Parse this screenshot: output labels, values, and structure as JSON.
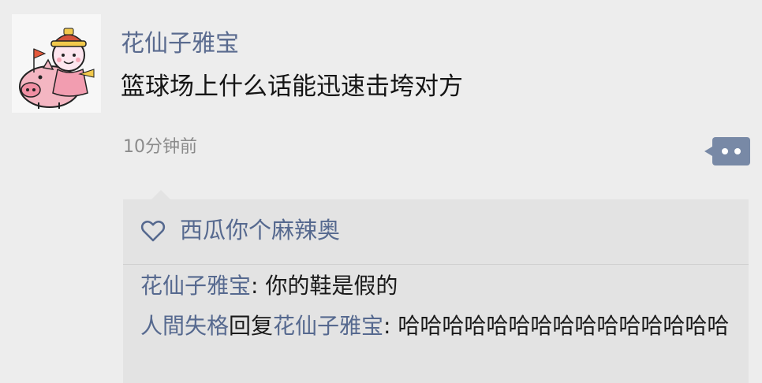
{
  "post": {
    "username": "花仙子雅宝",
    "text": "篮球场上什么话能迅速击垮对方",
    "time": "10分钟前"
  },
  "likes": {
    "names": "西瓜你个麻辣奥"
  },
  "comments": [
    {
      "user": "花仙子雅宝",
      "separator": ": ",
      "text": "你的鞋是假的"
    },
    {
      "user": "人間失格",
      "reply_word": "回复",
      "reply_to": "花仙子雅宝",
      "separator": ": ",
      "text": "哈哈哈哈哈哈哈哈哈哈哈哈哈哈哈"
    }
  ],
  "colors": {
    "link_blue": "#56698f",
    "more_button": "#7889a6",
    "background": "#ededed",
    "comment_bg": "#e3e3e3"
  },
  "icons": {
    "more": "ellipsis-two-dots-icon",
    "like": "heart-outline-icon"
  }
}
